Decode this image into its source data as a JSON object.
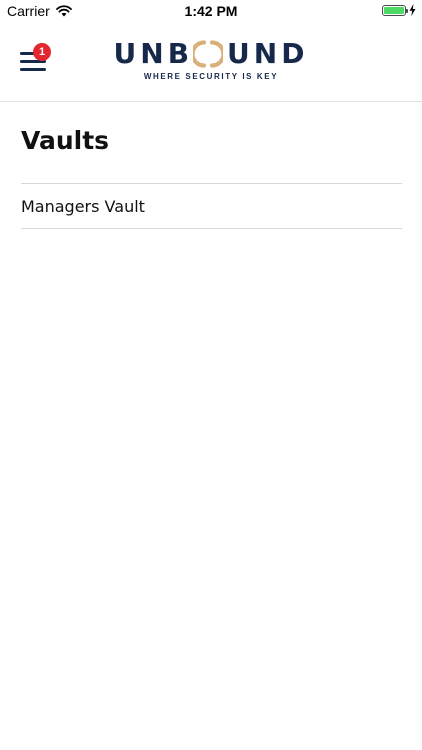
{
  "status_bar": {
    "carrier": "Carrier",
    "time": "1:42 PM",
    "battery_level": 1.0,
    "icons": [
      "wifi-icon",
      "battery-icon",
      "charging-bolt-icon"
    ]
  },
  "header": {
    "menu_badge_count": "1",
    "logo": {
      "wordmark": "UNBOUND",
      "tagline": "WHERE SECURITY IS KEY"
    },
    "icons": [
      "menu-icon"
    ]
  },
  "page": {
    "title": "Vaults"
  },
  "vaults": {
    "items": [
      {
        "label": "Managers Vault"
      }
    ]
  },
  "colors": {
    "brand_navy": "#16294a",
    "brand_gold": "#d9b07a",
    "badge_red": "#e3262f",
    "battery_green": "#4cd964",
    "divider": "#d6d6d6"
  }
}
